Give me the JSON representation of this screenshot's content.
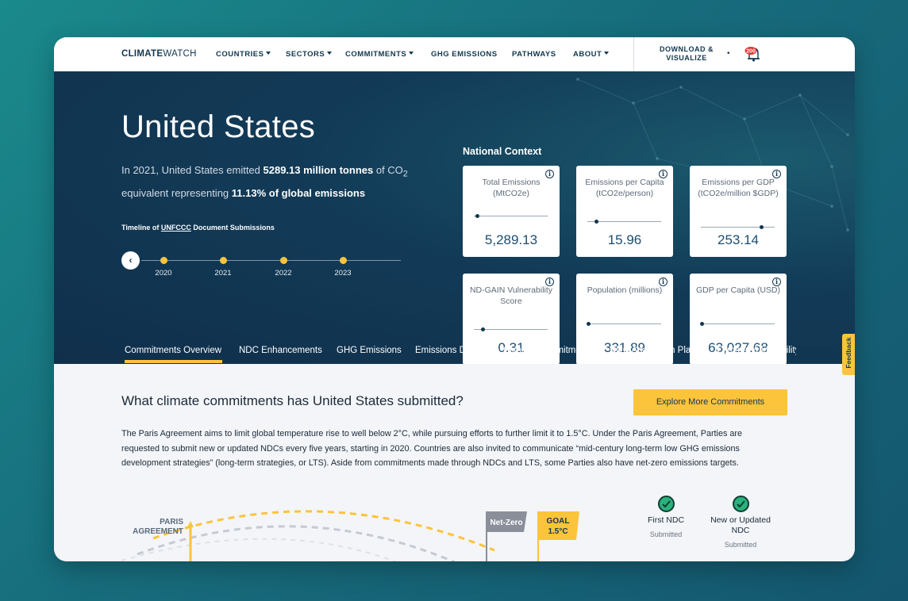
{
  "nav": {
    "logo_bold": "CLIMATE",
    "logo_light": "WATCH",
    "items": [
      {
        "label": "COUNTRIES",
        "dropdown": true
      },
      {
        "label": "SECTORS",
        "dropdown": true
      },
      {
        "label": "COMMITMENTS",
        "dropdown": true
      },
      {
        "label": "GHG EMISSIONS",
        "dropdown": false
      },
      {
        "label": "PATHWAYS",
        "dropdown": false
      },
      {
        "label": "ABOUT",
        "dropdown": true
      }
    ],
    "download_line1": "DOWNLOAD &",
    "download_line2": "VISUALIZE",
    "download_dot": "•",
    "notification_count": "200",
    "notification_icon": "bell-icon"
  },
  "hero": {
    "country": "United States",
    "summary_prefix": "In 2021, United States emitted ",
    "summary_emissions": "5289.13 million tonnes",
    "summary_mid": " of CO",
    "summary_sub": "2",
    "summary_line2_prefix": "equivalent representing ",
    "summary_share": "11.13% of global emissions",
    "timeline_title_prefix": "Timeline of ",
    "timeline_title_org": "UNFCCC",
    "timeline_title_suffix": " Document Submissions",
    "timeline_back": "‹",
    "timeline_years": [
      "2020",
      "2021",
      "2022",
      "2023"
    ],
    "national_context_title": "National Context",
    "cards": [
      {
        "label": "Total Emissions (MtCO2e)",
        "value": "5,289.13",
        "level": 0.05
      },
      {
        "label": "Emissions per Capita (tCO2e/person)",
        "value": "15.96",
        "level": 0.12
      },
      {
        "label": "Emissions per GDP (tCO2e/million $GDP)",
        "value": "253.14",
        "level": 0.82
      },
      {
        "label": "ND-GAIN Vulnerability Score",
        "value": "0.31",
        "level": 0.12
      },
      {
        "label": "Population (millions)",
        "value": "331.89",
        "level": 0.02
      },
      {
        "label": "GDP per Capita (USD)",
        "value": "63,027.68",
        "level": 0.02
      }
    ],
    "info_glyph": "i"
  },
  "tabs": [
    {
      "label": "Commitments Overview",
      "active": true
    },
    {
      "label": "NDC Enhancements",
      "active": false
    },
    {
      "label": "GHG Emissions",
      "active": false
    },
    {
      "label": "Emissions Drivers",
      "active": false
    },
    {
      "label": "Climate Commitments",
      "active": false
    },
    {
      "label": "NDC Adaptation Plans",
      "active": false
    },
    {
      "label": "Climate Vulnerability",
      "active": false
    }
  ],
  "feedback_label": "Feedback",
  "content": {
    "question": "What climate commitments has United States submitted?",
    "explore_button": "Explore More Commitments",
    "paragraph_line1": "The Paris Agreement aims to limit global temperature rise to well below 2°C, while pursuing efforts to further limit it to 1.5°C. Under the Paris Agreement, Parties are",
    "paragraph_line2": "requested to submit new or updated NDCs every five years, starting in 2020. Countries are also invited to communicate “mid-century long-term low GHG emissions",
    "paragraph_line3": "development strategies” (long-term strategies, or LTS). Aside from commitments made through NDCs and LTS, some Parties also have net-zero emissions targets.",
    "illustration": {
      "paris_label_1": "PARIS",
      "paris_label_2": "AGREEMENT",
      "net_zero_flag": "Net-Zero",
      "goal_flag_1": "GOAL",
      "goal_flag_2": "1.5°C"
    },
    "status": [
      {
        "label_1": "First NDC",
        "label_2": "",
        "sub": "Submitted",
        "icon": "check-circle-icon"
      },
      {
        "label_1": "New or Updated",
        "label_2": "NDC",
        "sub": "Submitted",
        "icon": "check-circle-icon"
      }
    ]
  },
  "colors": {
    "accent": "#fbc43a",
    "hero_bg": "#123b57",
    "navy": "#113750",
    "check": "#2ab27b"
  }
}
